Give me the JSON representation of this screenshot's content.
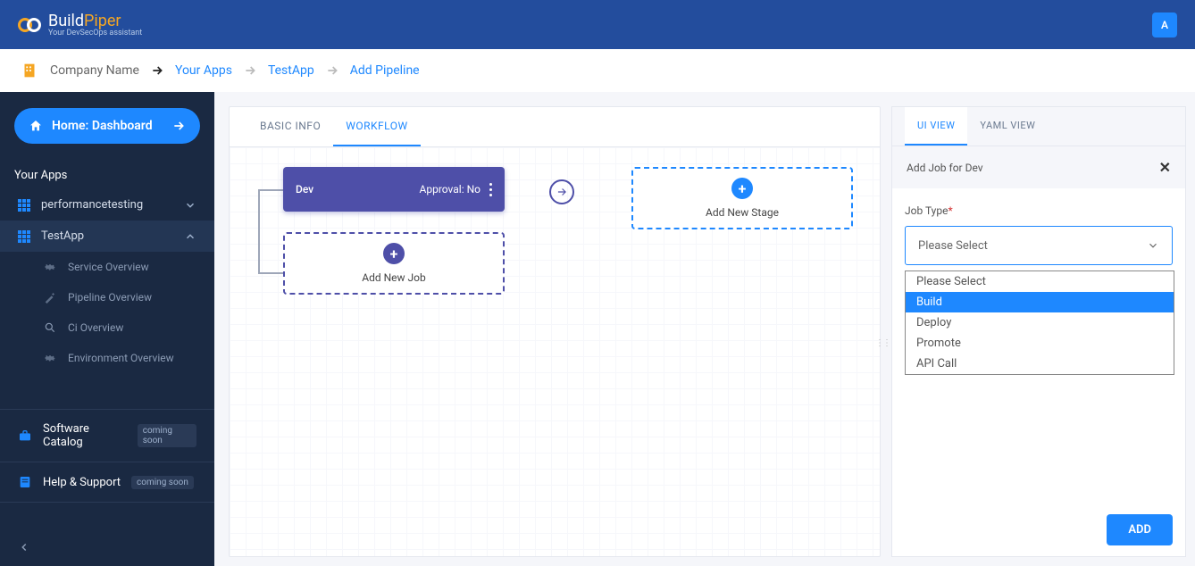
{
  "brand": {
    "name_a": "Build",
    "name_b": "Piper",
    "tagline": "Your DevSecOps assistant"
  },
  "avatar_letter": "A",
  "breadcrumb": {
    "company": "Company Name",
    "items": [
      "Your Apps",
      "TestApp",
      "Add Pipeline"
    ]
  },
  "sidebar": {
    "home": "Home: Dashboard",
    "section": "Your Apps",
    "apps": [
      {
        "name": "performancetesting",
        "expanded": false
      },
      {
        "name": "TestApp",
        "expanded": true
      }
    ],
    "subitems": [
      "Service Overview",
      "Pipeline Overview",
      "Ci Overview",
      "Environment Overview"
    ],
    "catalog": {
      "label": "Software Catalog",
      "badge": "coming soon"
    },
    "help": {
      "label": "Help & Support",
      "badge": "coming soon"
    }
  },
  "tabs": {
    "basic": "BASIC INFO",
    "workflow": "WORKFLOW"
  },
  "stage": {
    "name": "Dev",
    "approval": "Approval: No"
  },
  "add_job": "Add New Job",
  "add_stage": "Add New Stage",
  "right": {
    "tabs": {
      "ui": "UI VIEW",
      "yaml": "YAML VIEW"
    },
    "title": "Add Job for Dev",
    "field_label": "Job Type",
    "placeholder": "Please Select",
    "options": [
      "Please Select",
      "Build",
      "Deploy",
      "Promote",
      "API Call"
    ],
    "highlighted": "Build",
    "add_button": "ADD"
  }
}
